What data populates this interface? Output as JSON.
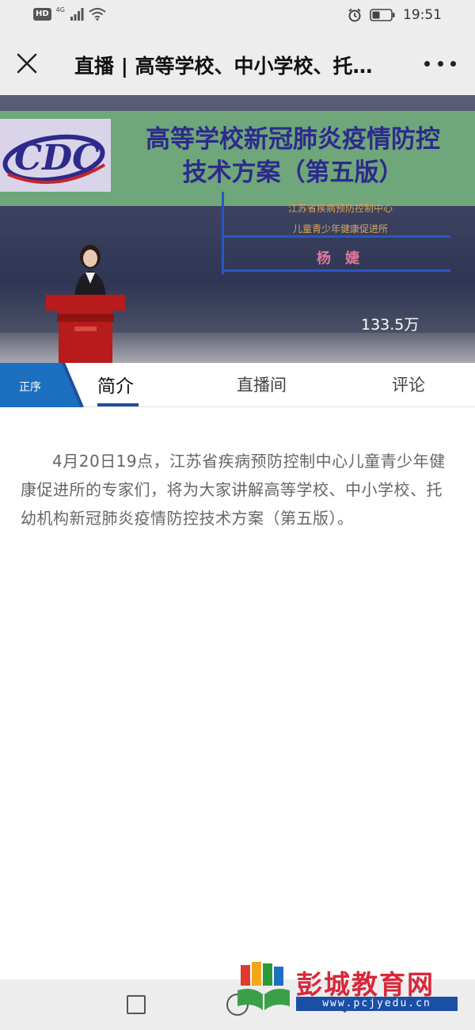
{
  "status_bar": {
    "hd": "HD",
    "network": "4G",
    "time": "19:51"
  },
  "header": {
    "title": "直播 | 高等学校、中小学校、托幼机构新冠肺炎疫情防控技术方案（第五版）"
  },
  "video": {
    "logo_text": "CDC",
    "banner_line1": "高等学校新冠肺炎疫情防控",
    "banner_line2": "技术方案（第五版）",
    "org_line1": "江苏省疾病预防控制中心",
    "org_line2": "儿童青少年健康促进所",
    "speaker_name": "杨 婕",
    "view_count": "133.5万"
  },
  "tabs": {
    "badge": "正序",
    "items": [
      {
        "label": "简介",
        "active": true
      },
      {
        "label": "直播间",
        "active": false
      },
      {
        "label": "评论",
        "active": false
      }
    ]
  },
  "content": {
    "description": "4月20日19点，江苏省疾病预防控制中心儿童青少年健康促进所的专家们，将为大家讲解高等学校、中小学校、托幼机构新冠肺炎疫情防控技术方案（第五版）。"
  },
  "watermark": {
    "title": "彭城教育网",
    "url": "www.pcjyedu.cn"
  },
  "colors": {
    "accent": "#1c4f9c",
    "badge": "#1c6fbf",
    "watermark_red": "#d8283a",
    "watermark_blue": "#1a4fa6"
  }
}
